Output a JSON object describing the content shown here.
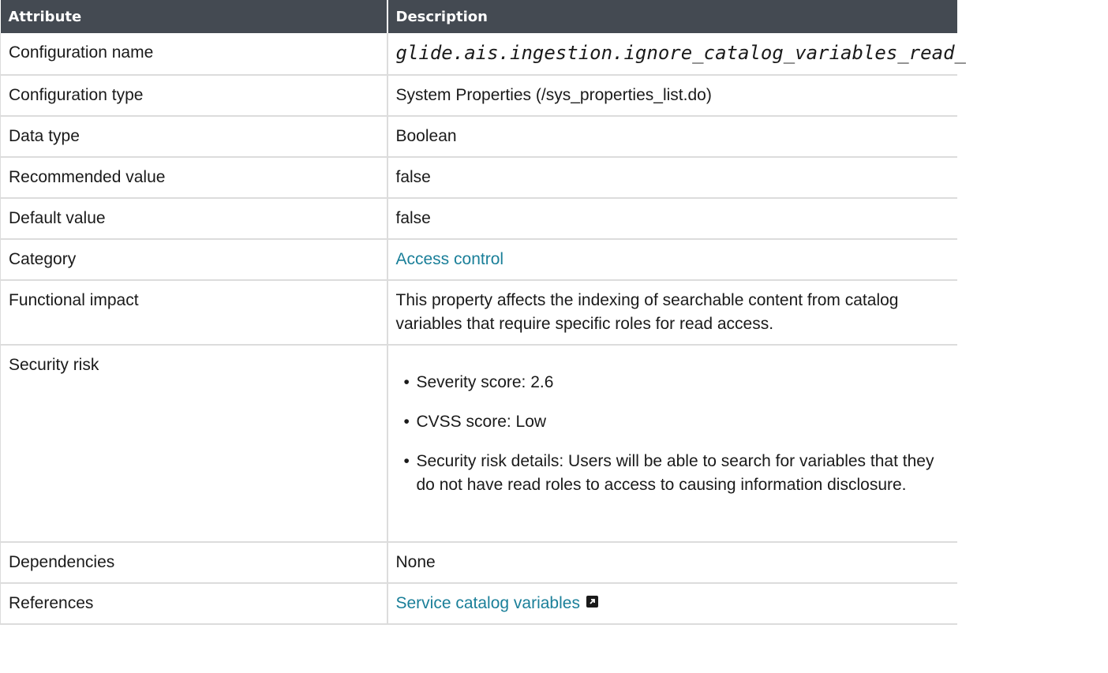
{
  "table": {
    "headers": {
      "attribute": "Attribute",
      "description": "Description"
    },
    "rows": {
      "config_name": {
        "label": "Configuration name",
        "value": "glide.ais.ingestion.ignore_catalog_variables_read_"
      },
      "config_type": {
        "label": "Configuration type",
        "value": "System Properties (/sys_properties_list.do)"
      },
      "data_type": {
        "label": "Data type",
        "value": "Boolean"
      },
      "recommended_value": {
        "label": "Recommended value",
        "value": "false"
      },
      "default_value": {
        "label": "Default value",
        "value": "false"
      },
      "category": {
        "label": "Category",
        "value": "Access control"
      },
      "functional_impact": {
        "label": "Functional impact",
        "value": "This property affects the indexing of searchable content from catalog variables that require specific roles for read access."
      },
      "security_risk": {
        "label": "Security risk",
        "items": [
          "Severity score: 2.6",
          "CVSS score: Low",
          "Security risk details: Users will be able to search for variables that they do not have read roles to access to causing information disclosure."
        ]
      },
      "dependencies": {
        "label": "Dependencies",
        "value": "None"
      },
      "references": {
        "label": "References",
        "value": "Service catalog variables",
        "icon": "external-link-icon"
      }
    }
  },
  "colors": {
    "header_bg": "#444a52",
    "link": "#1a7f99",
    "border": "#dcdcdc"
  }
}
